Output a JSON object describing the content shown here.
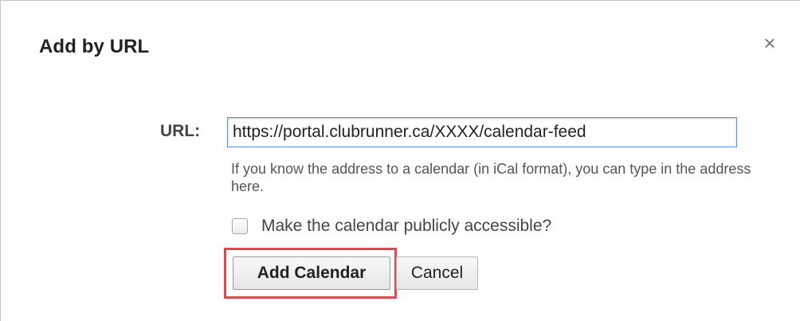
{
  "dialog": {
    "title": "Add by URL",
    "close_glyph": "×",
    "close_icon": "close-icon"
  },
  "url_field": {
    "label": "URL:",
    "value": "https://portal.clubrunner.ca/XXXX/calendar-feed"
  },
  "help_text": "If you know the address to a calendar (in iCal format), you can type in the address here.",
  "public_option": {
    "label": "Make the calendar publicly accessible?",
    "checked": false
  },
  "buttons": {
    "add_label": "Add Calendar",
    "cancel_label": "Cancel"
  },
  "colors": {
    "highlight": "#e0484c",
    "input_focus_border": "#4d90fe"
  }
}
